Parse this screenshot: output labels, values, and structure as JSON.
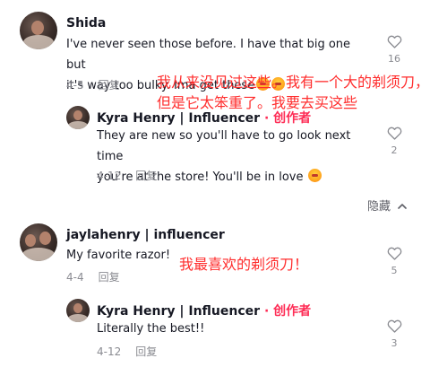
{
  "comments": [
    {
      "username": "Shida",
      "text_line1": "I've never seen those before. I have that big one but",
      "text_line2": "it's way too bulky. Ima get these",
      "date": "4-5",
      "reply_label": "回复",
      "likes": "16",
      "annotation_line1": "我从来没见过这些。我有一个大的剃须刀，",
      "annotation_line2": "但是它太笨重了。我要去买这些",
      "replies": [
        {
          "username": "Kyra Henry | Influencer",
          "author_badge": "· 创作者",
          "text_line1": "They are new so you'll have to go look next time",
          "text_line2": "you're at the store! You'll be in love",
          "date": "4-12",
          "reply_label": "回复",
          "likes": "2"
        }
      ]
    },
    {
      "username": "jaylahenry | influencer",
      "text_line1": "My favorite razor!",
      "date": "4-4",
      "reply_label": "回复",
      "likes": "5",
      "annotation": "我最喜欢的剃须刀！",
      "replies": [
        {
          "username": "Kyra Henry | Influencer",
          "author_badge": "· 创作者",
          "text_line1": "Literally the best!!",
          "date": "4-12",
          "reply_label": "回复",
          "likes": "3"
        }
      ]
    }
  ],
  "hide_label": "隐藏",
  "icons": {
    "like": "heart-outline-icon",
    "hide": "chevron-up-icon",
    "emoji": "heart-eyes-emoji-icon"
  },
  "colors": {
    "creator_badge": "#fe2c55",
    "annotation": "#ff2d2d",
    "meta": "#8a8b91"
  }
}
